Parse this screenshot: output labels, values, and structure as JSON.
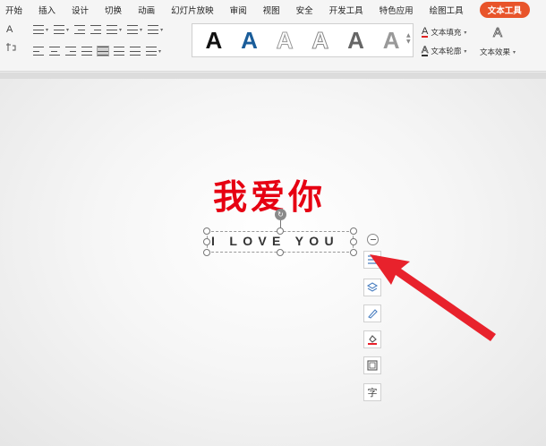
{
  "menu": {
    "items": [
      "开始",
      "插入",
      "设计",
      "切换",
      "动画",
      "幻灯片放映",
      "审阅",
      "视图",
      "安全",
      "开发工具",
      "特色应用",
      "绘图工具"
    ],
    "active_tab": "文本工具"
  },
  "ribbon": {
    "font_size_icon": "A",
    "style_letter": "A",
    "text_fill_label": "文本填充",
    "text_outline_label": "文本轮廓",
    "text_effect_label": "文本效果",
    "colors": {
      "fill_underline": "#dd2222",
      "style_blue": "#1a5d9a"
    }
  },
  "slide": {
    "title_text": "我爱你",
    "title_color": "#e60012",
    "textbox_text": "I LOVE YOU",
    "toolbar_char": "字"
  },
  "colors": {
    "active_tab": "#e8542a",
    "arrow": "#e8222c"
  }
}
